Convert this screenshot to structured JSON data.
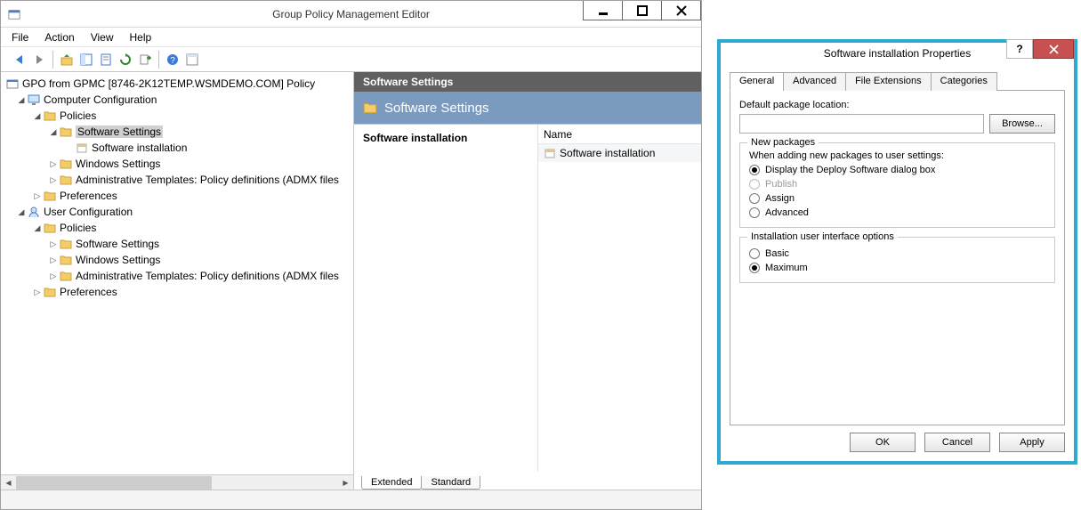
{
  "main": {
    "title": "Group Policy Management Editor",
    "menu": {
      "file": "File",
      "action": "Action",
      "view": "View",
      "help": "Help"
    },
    "tree": {
      "root": "GPO from GPMC [8746-2K12TEMP.WSMDEMO.COM] Policy",
      "cc": "Computer Configuration",
      "policies": "Policies",
      "sw_settings": "Software Settings",
      "sw_install": "Software installation",
      "win_settings": "Windows Settings",
      "admin_tpl": "Administrative Templates: Policy definitions (ADMX files",
      "prefs": "Preferences",
      "uc": "User Configuration"
    },
    "detail": {
      "band1": "Software Settings",
      "band2": "Software Settings",
      "left_label": "Software installation",
      "col_name": "Name",
      "row0": "Software installation"
    },
    "tabs_bottom": {
      "extended": "Extended",
      "standard": "Standard"
    }
  },
  "dlg": {
    "title": "Software installation Properties",
    "tabs": {
      "general": "General",
      "advanced": "Advanced",
      "file_ext": "File Extensions",
      "categories": "Categories"
    },
    "default_loc_label": "Default package location:",
    "browse": "Browse...",
    "group_newpkg": {
      "title": "New packages",
      "caption": "When adding new packages to user settings:",
      "opt_display": "Display the Deploy Software dialog box",
      "opt_publish": "Publish",
      "opt_assign": "Assign",
      "opt_advanced": "Advanced"
    },
    "group_ui": {
      "title": "Installation user interface options",
      "opt_basic": "Basic",
      "opt_maximum": "Maximum"
    },
    "ok": "OK",
    "cancel": "Cancel",
    "apply": "Apply"
  }
}
